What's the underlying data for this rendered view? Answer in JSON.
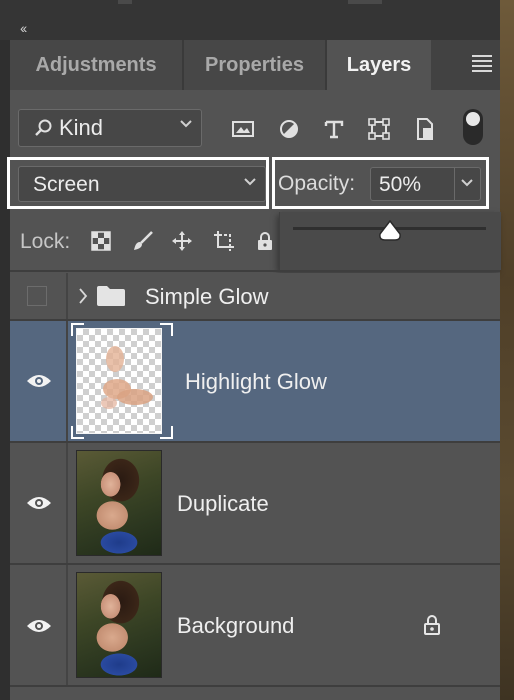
{
  "top_bar": {
    "collapse_glyph": "‹‹"
  },
  "tabs": [
    {
      "label": "Adjustments",
      "active": false
    },
    {
      "label": "Properties",
      "active": false
    },
    {
      "label": "Layers",
      "active": true
    }
  ],
  "filter": {
    "kind_label": "Kind",
    "icons": [
      "pixel-filter-icon",
      "adjustment-filter-icon",
      "type-filter-icon",
      "shape-filter-icon",
      "smart-object-filter-icon"
    ]
  },
  "blend": {
    "mode": "Screen",
    "opacity_label": "Opacity:",
    "opacity_value": "50%",
    "opacity_fraction": 0.5
  },
  "lock": {
    "label": "Lock:",
    "icons": [
      "lock-transparent-pixels-icon",
      "lock-image-pixels-icon",
      "lock-position-icon",
      "lock-artboard-icon",
      "lock-all-icon"
    ]
  },
  "layers": [
    {
      "name": "Simple Glow",
      "type": "group",
      "visible": false,
      "selected": false
    },
    {
      "name": "Highlight Glow",
      "type": "pixel",
      "visible": true,
      "selected": true
    },
    {
      "name": "Duplicate",
      "type": "pixel",
      "visible": true,
      "selected": false
    },
    {
      "name": "Background",
      "type": "pixel",
      "visible": true,
      "selected": false,
      "locked": true
    }
  ],
  "colors": {
    "panel_bg": "#535353",
    "selected_row": "#55677f",
    "highlight_outline": "#ffffff"
  }
}
